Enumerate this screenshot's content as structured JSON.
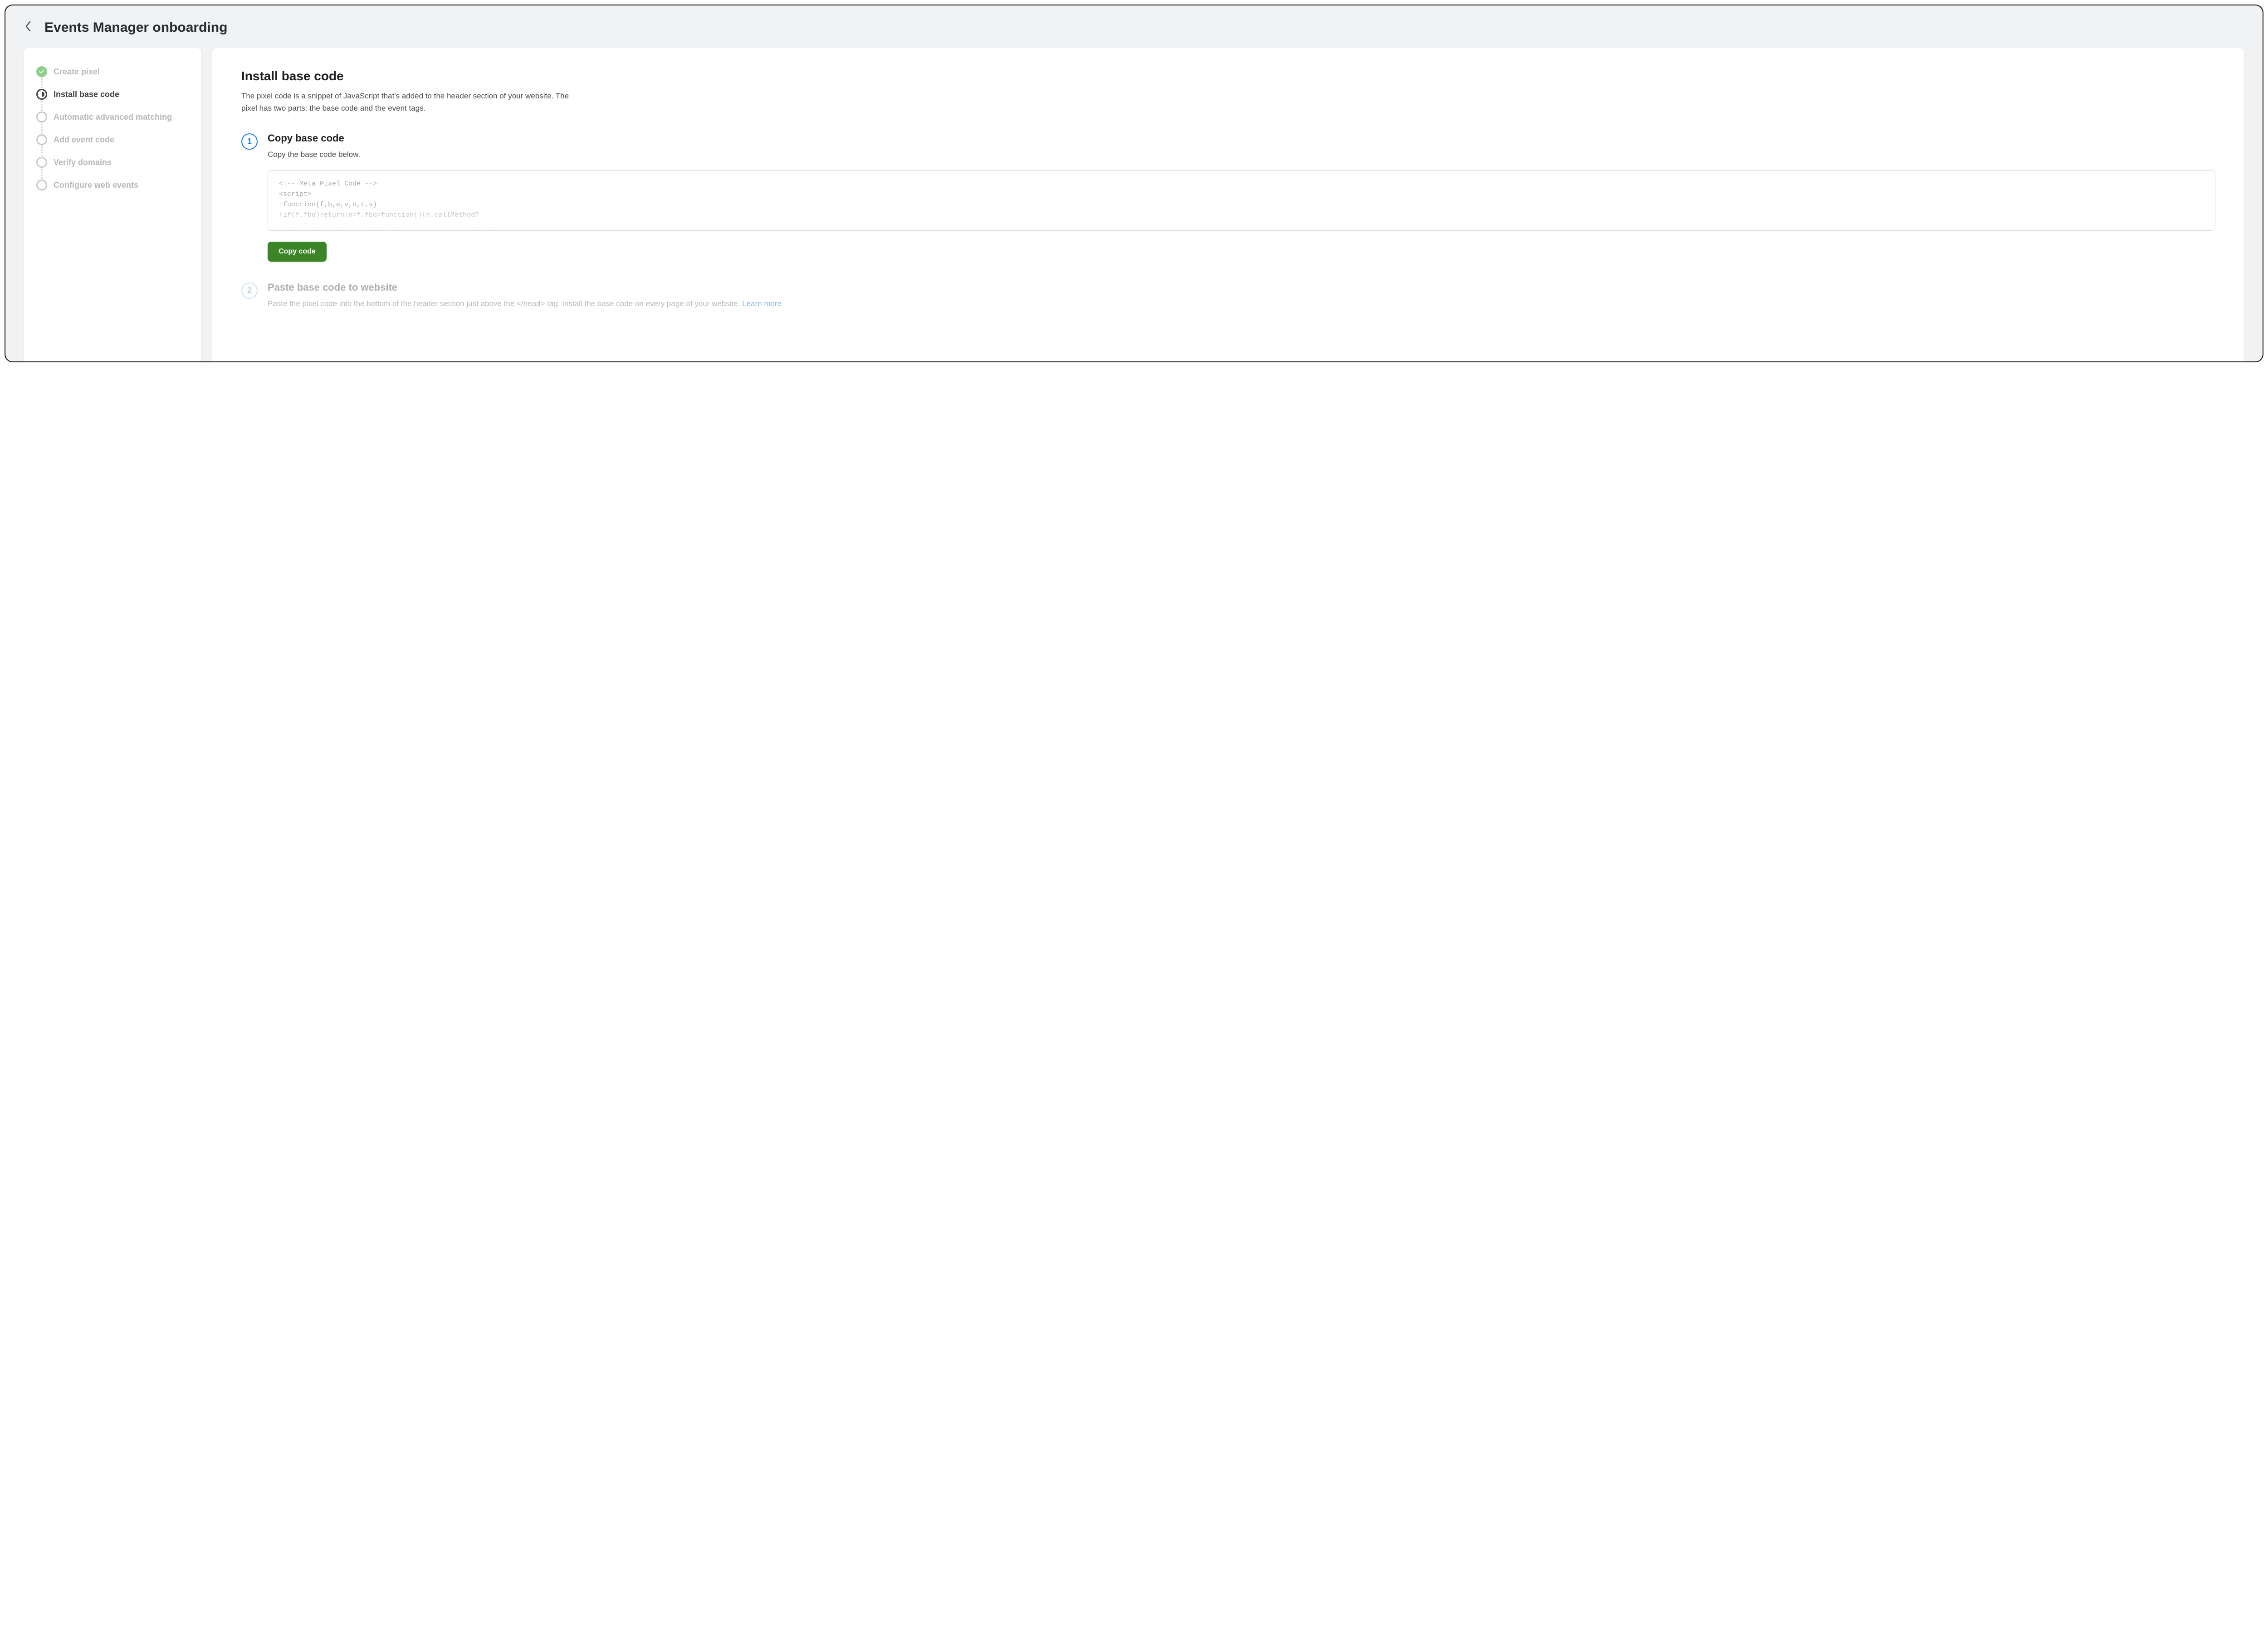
{
  "header": {
    "title": "Events Manager onboarding"
  },
  "sidebar": {
    "steps": [
      {
        "label": "Create pixel",
        "state": "complete"
      },
      {
        "label": "Install base code",
        "state": "current"
      },
      {
        "label": "Automatic advanced matching",
        "state": "upcoming"
      },
      {
        "label": "Add event code",
        "state": "upcoming"
      },
      {
        "label": "Verify domains",
        "state": "upcoming"
      },
      {
        "label": "Configure web events",
        "state": "upcoming"
      }
    ]
  },
  "main": {
    "title": "Install base code",
    "description": "The pixel code is a snippet of JavaScript that's added to the header section of your website. The pixel has two parts: the base code and the event tags.",
    "substeps": [
      {
        "num": "1",
        "title": "Copy base code",
        "text": "Copy the base code below.",
        "code": "<!-- Meta Pixel Code -->\n<script>\n!function(f,b,e,v,n,t,s)\n{if(f.fbq)return;n=f.fbq=function(){n.callMethod?\nn.callMethod.apply(n,arguments):n.queue.push(arguments)};",
        "copy_button": "Copy code",
        "disabled": false
      },
      {
        "num": "2",
        "title": "Paste base code to website",
        "text": "Paste the pixel code into the bottom of the header section just above the </head> tag. Install the base code on every page of your website.",
        "learn_more": "Learn more",
        "disabled": true
      }
    ]
  }
}
